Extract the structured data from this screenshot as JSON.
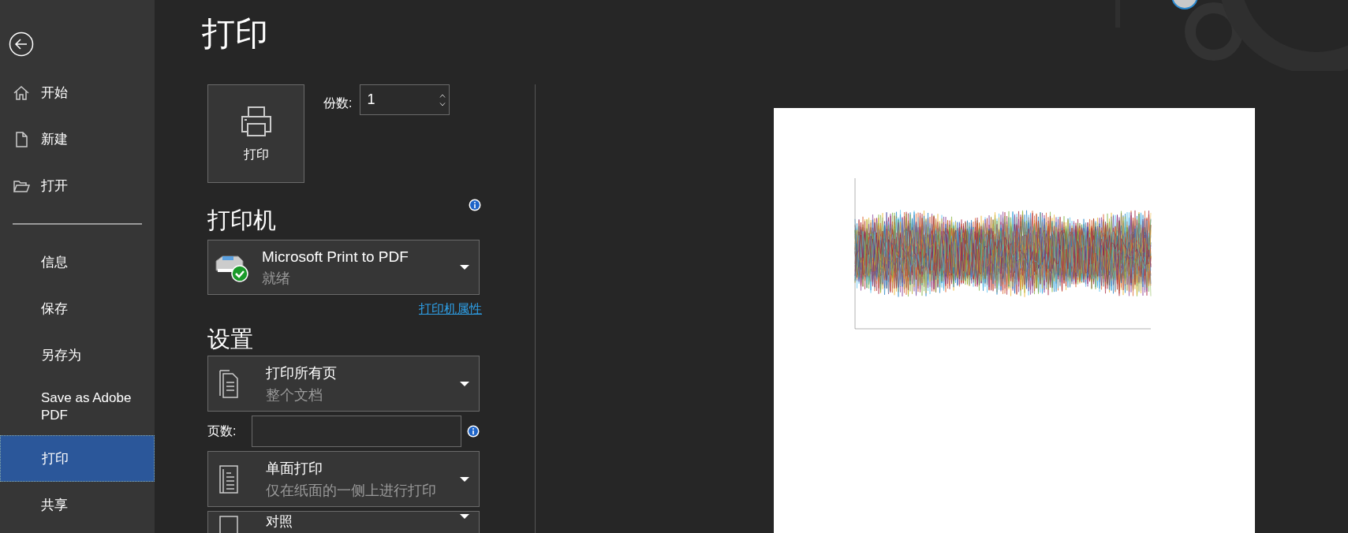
{
  "page_title": "打印",
  "nav_top": [
    {
      "label": "开始",
      "selected": false
    },
    {
      "label": "新建",
      "selected": false
    },
    {
      "label": "打开",
      "selected": false
    }
  ],
  "nav_bottom": [
    {
      "label": "信息",
      "selected": false
    },
    {
      "label": "保存",
      "selected": false
    },
    {
      "label": "另存为",
      "selected": false
    },
    {
      "label": "Save as Adobe PDF",
      "selected": false
    },
    {
      "label": "打印",
      "selected": true
    },
    {
      "label": "共享",
      "selected": false
    }
  ],
  "print_button": "打印",
  "copies": {
    "label": "份数:",
    "value": "1"
  },
  "printer": {
    "heading": "打印机",
    "name": "Microsoft Print to PDF",
    "status": "就绪",
    "properties_link": "打印机属性"
  },
  "settings": {
    "heading": "设置",
    "dropdowns": [
      {
        "title": "打印所有页",
        "subtitle": "整个文档"
      },
      {
        "title": "单面打印",
        "subtitle": "仅在纸面的一侧上进行打印"
      },
      {
        "title": "对照"
      }
    ],
    "pages": {
      "label": "页数:"
    }
  },
  "preview": {
    "kind": "waveform"
  }
}
